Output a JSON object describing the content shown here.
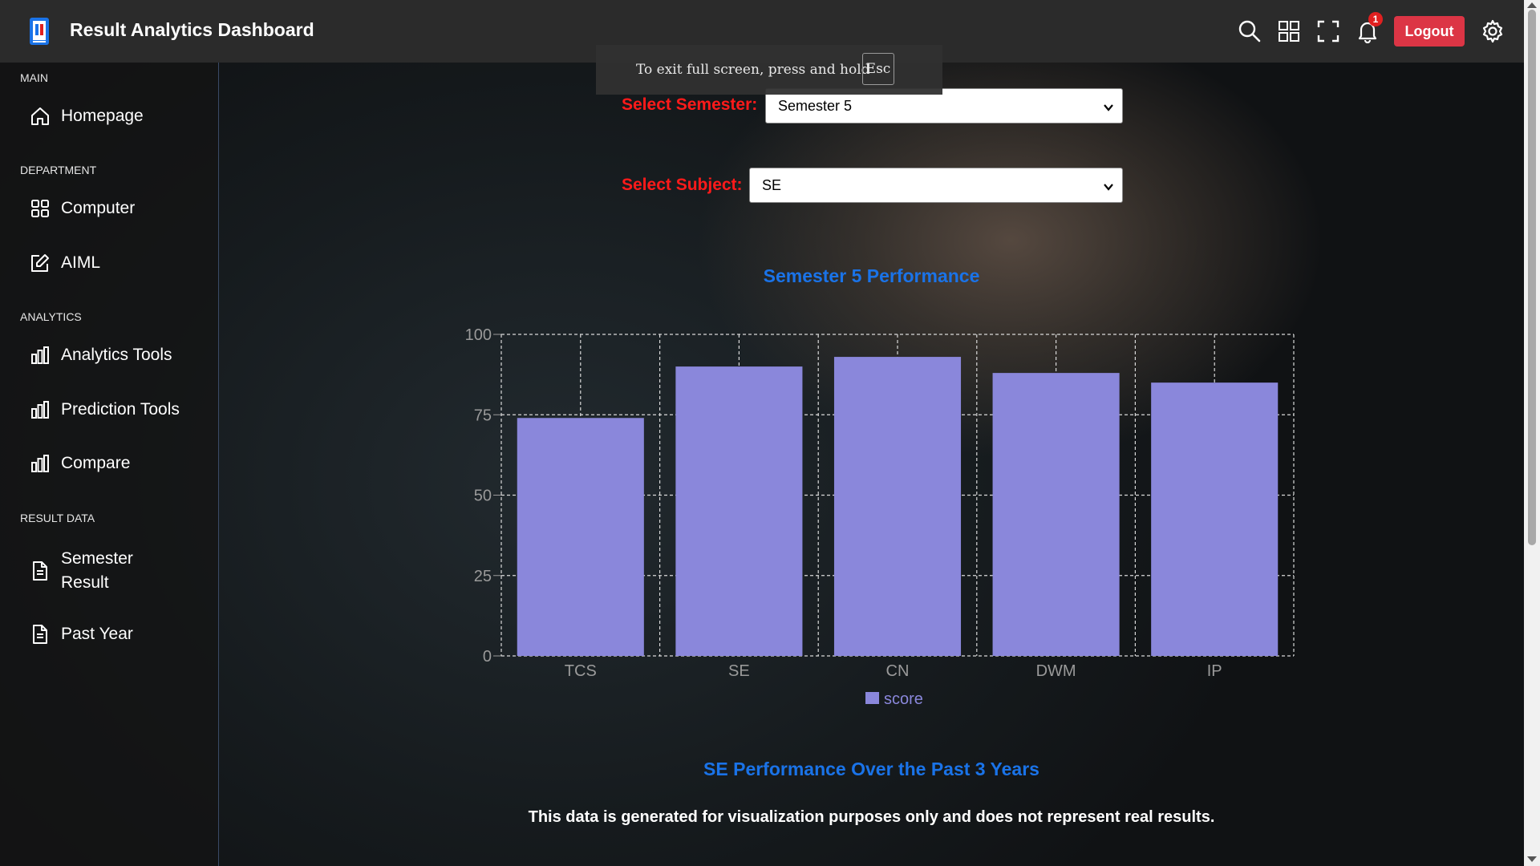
{
  "header": {
    "title": "Result Analytics Dashboard",
    "notification_count": "1",
    "logout_label": "Logout",
    "icons": [
      "search-icon",
      "apps-grid-icon",
      "fullscreen-icon",
      "bell-icon",
      "gear-icon"
    ]
  },
  "fullscreen_toast": {
    "text": "To exit full screen, press and hold",
    "key": "Esc"
  },
  "sidebar": {
    "sections": [
      {
        "title": "MAIN",
        "items": [
          {
            "label": "Homepage",
            "icon": "home-icon"
          }
        ]
      },
      {
        "title": "DEPARTMENT",
        "items": [
          {
            "label": "Computer",
            "icon": "grid-icon"
          },
          {
            "label": "AIML",
            "icon": "edit-icon"
          }
        ]
      },
      {
        "title": "ANALYTICS",
        "items": [
          {
            "label": "Analytics Tools",
            "icon": "bar-chart-icon"
          },
          {
            "label": "Prediction Tools",
            "icon": "bar-chart-icon"
          },
          {
            "label": "Compare",
            "icon": "bar-chart-icon"
          }
        ]
      },
      {
        "title": "RESULT DATA",
        "items": [
          {
            "label": "Semester",
            "label_line2": "Result",
            "icon": "document-icon"
          },
          {
            "label": "Past Year",
            "icon": "document-icon"
          }
        ]
      }
    ]
  },
  "filters": {
    "semester_label": "Select Semester:",
    "semester_value": "Semester 5",
    "subject_label": "Select Subject:",
    "subject_value": "SE"
  },
  "chart_title": "Semester 5 Performance",
  "chart_data": {
    "type": "bar",
    "categories": [
      "TCS",
      "SE",
      "CN",
      "DWM",
      "IP"
    ],
    "series": [
      {
        "name": "score",
        "values": [
          74,
          90,
          93,
          88,
          85
        ]
      }
    ],
    "ylim": [
      0,
      100
    ],
    "yticks": [
      0,
      25,
      50,
      75,
      100
    ],
    "grid": true,
    "legend": "bottom",
    "bar_color": "#8a87db"
  },
  "subject_heading": "SE Performance Over the Past 3 Years",
  "disclaimer": "This data is generated for visualization purposes only and does not represent real results.",
  "colors": {
    "accent_blue": "#1a73e8",
    "label_red": "#ff1a1a",
    "logout_red": "#dc3545"
  }
}
